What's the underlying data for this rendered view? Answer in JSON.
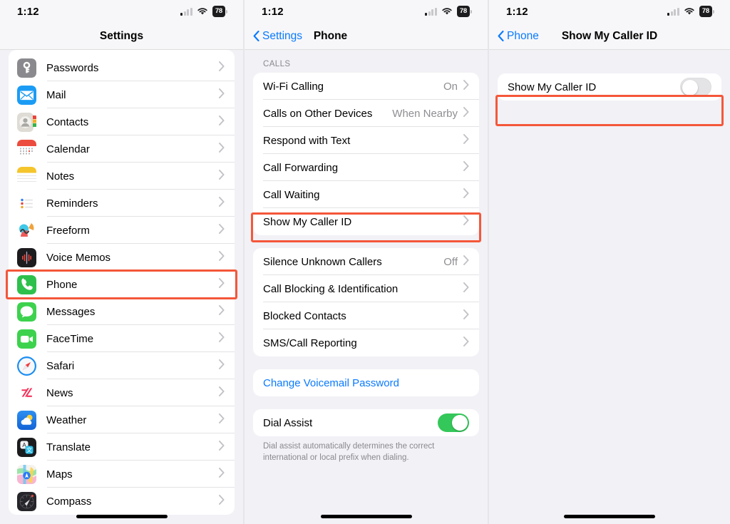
{
  "status_bar": {
    "time": "1:12",
    "battery_percent": "78",
    "cellular_icon": "cellular-bars-icon",
    "wifi_icon": "wifi-icon",
    "battery_icon": "battery-icon"
  },
  "highlight_color": "#f4573a",
  "panel_settings": {
    "title": "Settings",
    "items": [
      {
        "label": "Passwords",
        "icon": "passwords-icon",
        "highlighted": false
      },
      {
        "label": "Mail",
        "icon": "mail-icon",
        "highlighted": false
      },
      {
        "label": "Contacts",
        "icon": "contacts-icon",
        "highlighted": false
      },
      {
        "label": "Calendar",
        "icon": "calendar-icon",
        "highlighted": false
      },
      {
        "label": "Notes",
        "icon": "notes-icon",
        "highlighted": false
      },
      {
        "label": "Reminders",
        "icon": "reminders-icon",
        "highlighted": false
      },
      {
        "label": "Freeform",
        "icon": "freeform-icon",
        "highlighted": false
      },
      {
        "label": "Voice Memos",
        "icon": "voice-memos-icon",
        "highlighted": false
      },
      {
        "label": "Phone",
        "icon": "phone-icon",
        "highlighted": true
      },
      {
        "label": "Messages",
        "icon": "messages-icon",
        "highlighted": false
      },
      {
        "label": "FaceTime",
        "icon": "facetime-icon",
        "highlighted": false
      },
      {
        "label": "Safari",
        "icon": "safari-icon",
        "highlighted": false
      },
      {
        "label": "News",
        "icon": "news-icon",
        "highlighted": false
      },
      {
        "label": "Weather",
        "icon": "weather-icon",
        "highlighted": false
      },
      {
        "label": "Translate",
        "icon": "translate-icon",
        "highlighted": false
      },
      {
        "label": "Maps",
        "icon": "maps-icon",
        "highlighted": false
      },
      {
        "label": "Compass",
        "icon": "compass-icon",
        "highlighted": false
      }
    ]
  },
  "panel_phone": {
    "back_label": "Settings",
    "title": "Phone",
    "section_calls_header": "CALLS",
    "group_calls": [
      {
        "label": "Wi-Fi Calling",
        "value": "On",
        "highlighted": false
      },
      {
        "label": "Calls on Other Devices",
        "value": "When Nearby",
        "highlighted": false
      },
      {
        "label": "Respond with Text",
        "value": "",
        "highlighted": false
      },
      {
        "label": "Call Forwarding",
        "value": "",
        "highlighted": false
      },
      {
        "label": "Call Waiting",
        "value": "",
        "highlighted": false
      },
      {
        "label": "Show My Caller ID",
        "value": "",
        "highlighted": true
      }
    ],
    "group_blocking": [
      {
        "label": "Silence Unknown Callers",
        "value": "Off"
      },
      {
        "label": "Call Blocking & Identification",
        "value": ""
      },
      {
        "label": "Blocked Contacts",
        "value": ""
      },
      {
        "label": "SMS/Call Reporting",
        "value": ""
      }
    ],
    "group_voicemail": [
      {
        "label": "Change Voicemail Password"
      }
    ],
    "dial_assist": {
      "label": "Dial Assist",
      "enabled": true,
      "footnote": "Dial assist automatically determines the correct international or local prefix when dialing."
    }
  },
  "panel_caller_id": {
    "back_label": "Phone",
    "title": "Show My Caller ID",
    "row": {
      "label": "Show My Caller ID",
      "enabled": false,
      "highlighted": true
    }
  }
}
